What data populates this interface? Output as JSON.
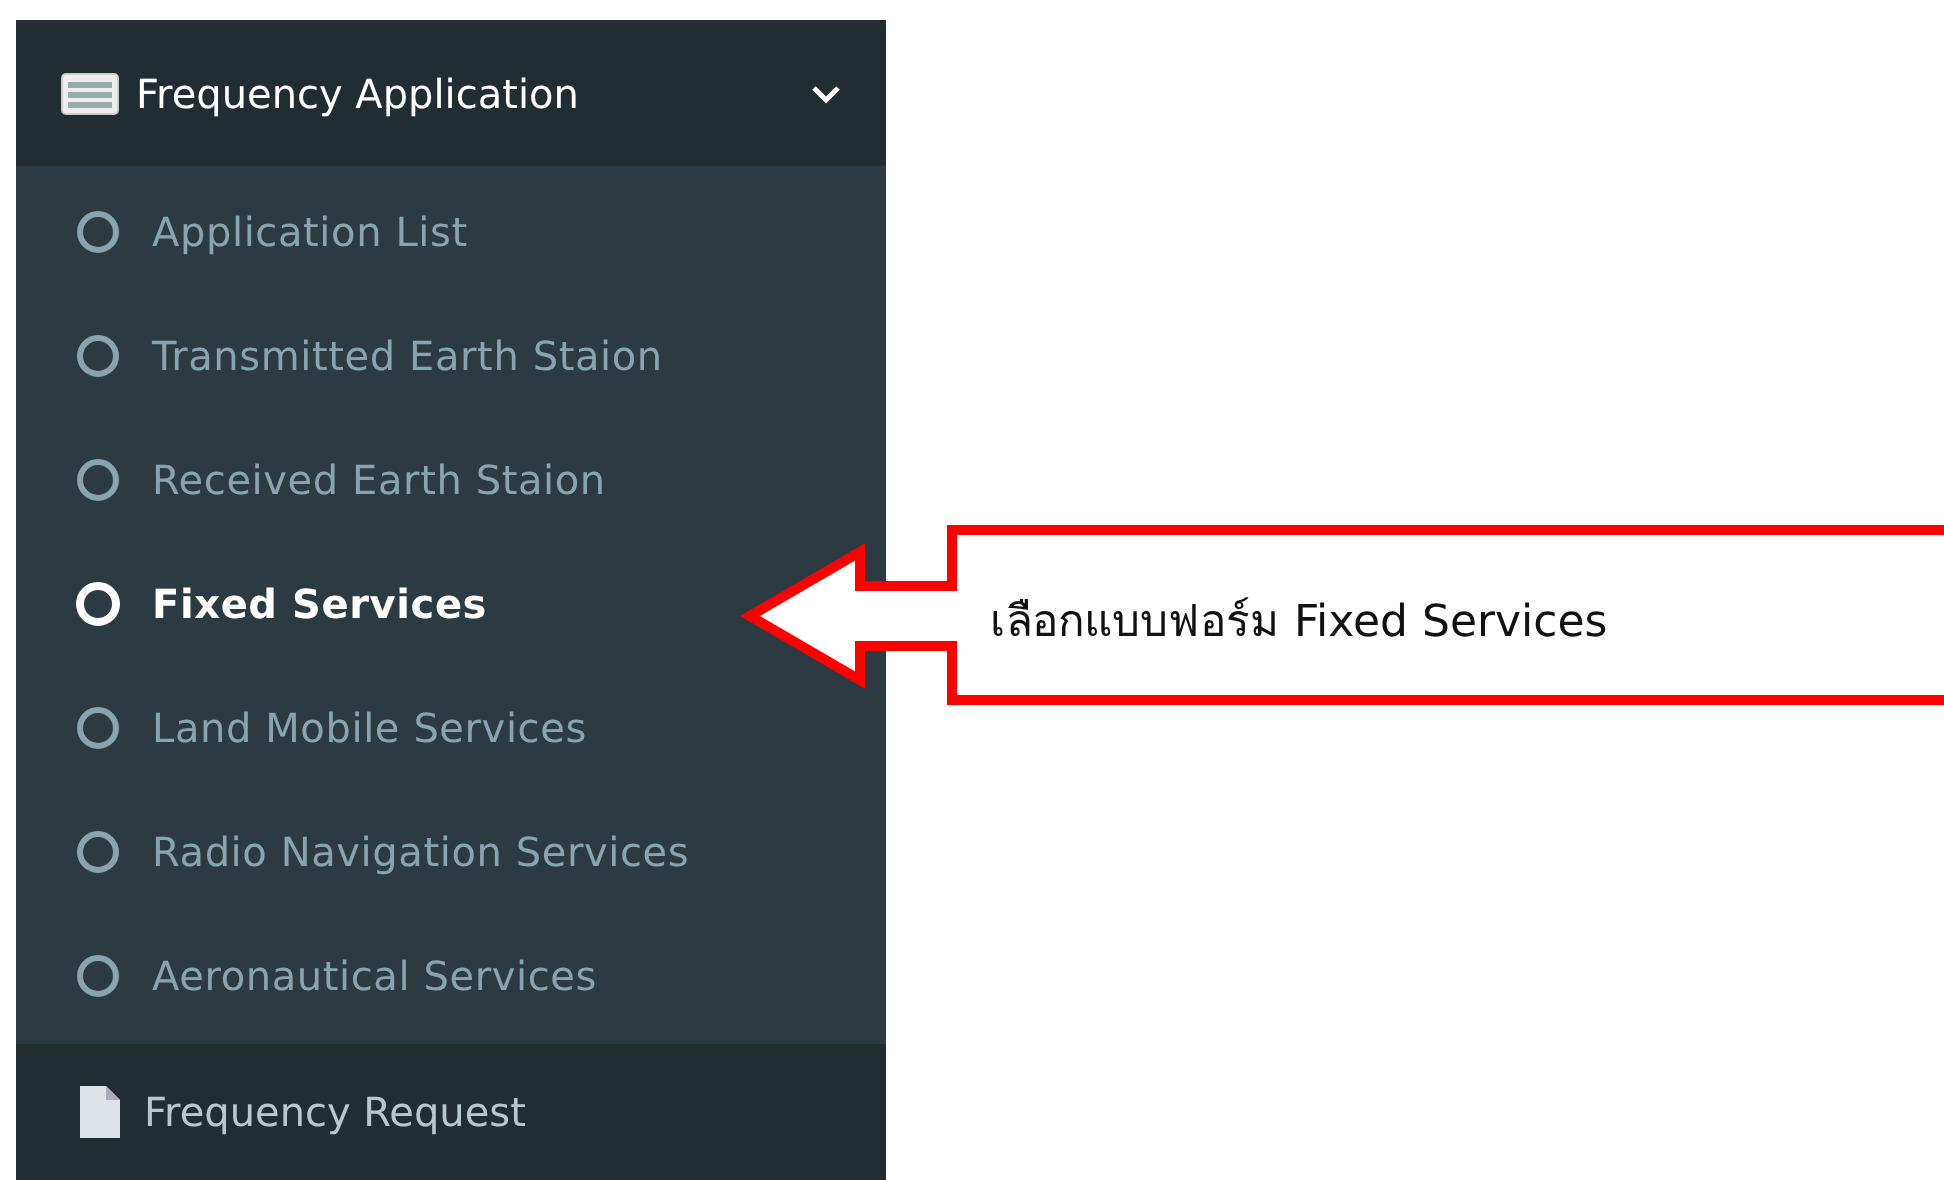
{
  "sidebar": {
    "menu": [
      {
        "kind": "folder",
        "label": "Frequency Application",
        "expanded": true,
        "items": [
          {
            "label": "Application List",
            "selected": false
          },
          {
            "label": "Transmitted Earth Staion",
            "selected": false
          },
          {
            "label": "Received Earth Staion",
            "selected": false
          },
          {
            "label": "Fixed Services",
            "selected": true
          },
          {
            "label": "Land Mobile Services",
            "selected": false
          },
          {
            "label": "Radio Navigation Services",
            "selected": false
          },
          {
            "label": "Aeronautical Services",
            "selected": false
          }
        ]
      },
      {
        "kind": "page",
        "label": "Frequency Request"
      }
    ]
  },
  "callout": {
    "text": "เลือกแบบฟอร์ม Fixed Services"
  }
}
